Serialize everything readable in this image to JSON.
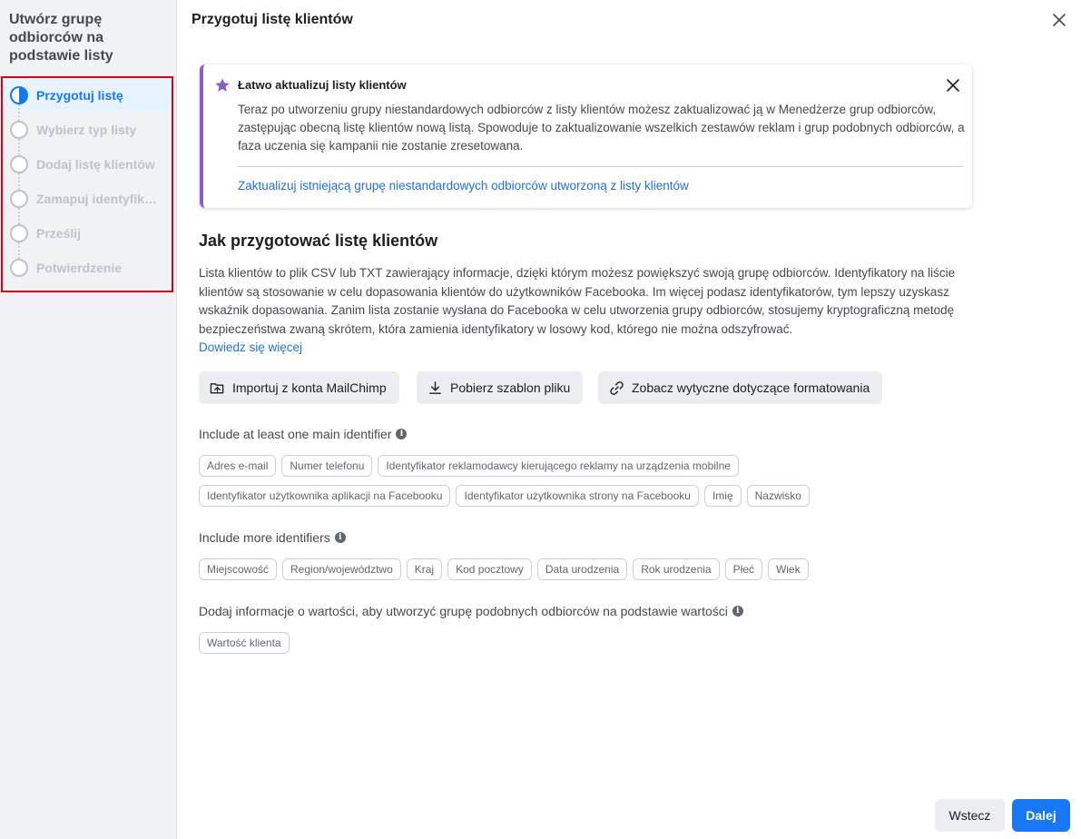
{
  "sidebar": {
    "title": "Utwórz grupę odbiorców na podstawie listy",
    "steps": [
      {
        "label": "Przygotuj listę",
        "active": true
      },
      {
        "label": "Wybierz typ listy",
        "active": false
      },
      {
        "label": "Dodaj listę klientów",
        "active": false
      },
      {
        "label": "Zamapuj identyfikatory",
        "active": false
      },
      {
        "label": "Prześlij",
        "active": false
      },
      {
        "label": "Potwierdzenie",
        "active": false
      }
    ]
  },
  "header": {
    "title": "Przygotuj listę klientów"
  },
  "info_card": {
    "title": "Łatwo aktualizuj listy klientów",
    "body": "Teraz po utworzeniu grupy niestandardowych odbiorców z listy klientów możesz zaktualizować ją w Menedżerze grup odbiorców, zastępując obecną listę klientów nową listą. Spowoduje to zaktualizowanie wszelkich zestawów reklam i grup podobnych odbiorców, a faza uczenia się kampanii nie zostanie zresetowana.",
    "link": "Zaktualizuj istniejącą grupę niestandardowych odbiorców utworzoną z listy klientów"
  },
  "section": {
    "title": "Jak przygotować listę klientów",
    "body": "Lista klientów to plik CSV lub TXT zawierający informacje, dzięki którym możesz powiększyć swoją grupę odbiorców. Identyfikatory na liście klientów są stosowanie w celu dopasowania klientów do użytkowników Facebooka. Im więcej podasz identyfikatorów, tym lepszy uzyskasz wskaźnik dopasowania. Zanim lista zostanie wysłana do Facebooka w celu utworzenia grupy odbiorców, stosujemy kryptograficzną metodę bezpieczeństwa zwaną skrótem, która zamienia identyfikatory w losowy kod, którego nie można odszyfrować.",
    "learn_more": "Dowiedz się więcej"
  },
  "actions": {
    "mailchimp": "Importuj z konta MailChimp",
    "template": "Pobierz szablon pliku",
    "guidelines": "Zobacz wytyczne dotyczące formatowania"
  },
  "main_identifiers": {
    "label": "Include at least one main identifier",
    "row1": [
      "Adres e-mail",
      "Numer telefonu",
      "Identyfikator reklamodawcy kierującego reklamy na urządzenia mobilne"
    ],
    "row2": [
      "Identyfikator użytkownika aplikacji na Facebooku",
      "Identyfikator użytkownika strony na Facebooku",
      "Imię",
      "Nazwisko"
    ]
  },
  "more_identifiers": {
    "label": "Include more identifiers",
    "row1": [
      "Miejscowość",
      "Region/województwo",
      "Kraj",
      "Kod pocztowy",
      "Data urodzenia",
      "Rok urodzenia",
      "Płeć",
      "Wiek"
    ]
  },
  "value_info": {
    "label": "Dodaj informacje o wartości, aby utworzyć grupę podobnych odbiorców na podstawie wartości",
    "row1": [
      "Wartość klienta"
    ]
  },
  "footer": {
    "back": "Wstecz",
    "next": "Dalej"
  }
}
